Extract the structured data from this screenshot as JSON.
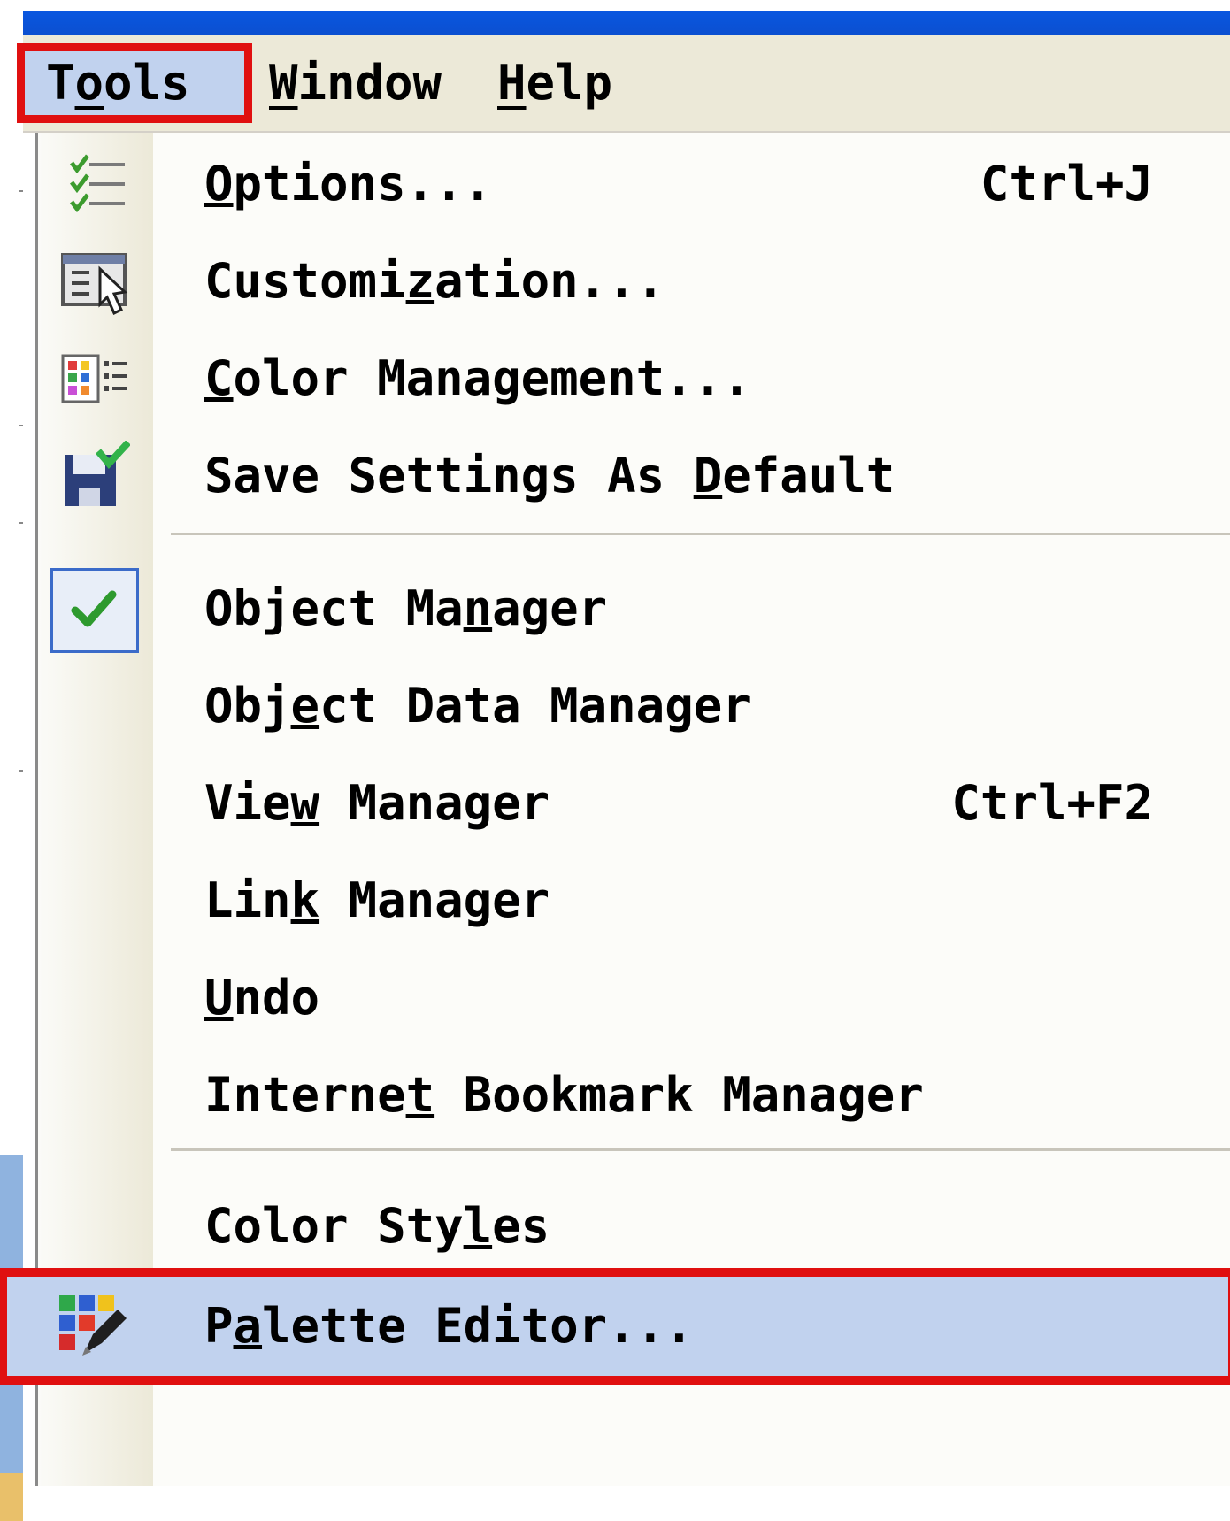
{
  "menubar": {
    "items": [
      {
        "pre": "T",
        "mn": "o",
        "post": "ols"
      },
      {
        "pre": "",
        "mn": "W",
        "post": "indow"
      },
      {
        "pre": "",
        "mn": "H",
        "post": "elp"
      }
    ]
  },
  "dropdown": {
    "items": [
      {
        "pre": "",
        "mn": "O",
        "post": "ptions...",
        "shortcut": "Ctrl+J",
        "icon": "options-checklist-icon"
      },
      {
        "pre": "Customi",
        "mn": "z",
        "post": "ation...",
        "shortcut": "",
        "icon": "customization-icon"
      },
      {
        "pre": "",
        "mn": "C",
        "post": "olor Management...",
        "shortcut": "",
        "icon": "color-management-icon"
      },
      {
        "pre": "Save Settings As ",
        "mn": "D",
        "post": "efault",
        "shortcut": "",
        "icon": "save-settings-icon"
      },
      {
        "pre": "Object Ma",
        "mn": "n",
        "post": "ager",
        "shortcut": "",
        "icon": "checkmark-icon",
        "checked": true
      },
      {
        "pre": "Obj",
        "mn": "e",
        "post": "ct Data Manager",
        "shortcut": ""
      },
      {
        "pre": "Vie",
        "mn": "w",
        "post": " Manager",
        "shortcut": "Ctrl+F2"
      },
      {
        "pre": "Lin",
        "mn": "k",
        "post": " Manager",
        "shortcut": ""
      },
      {
        "pre": "",
        "mn": "U",
        "post": "ndo",
        "shortcut": ""
      },
      {
        "pre": "Interne",
        "mn": "t",
        "post": " Bookmark Manager",
        "shortcut": ""
      },
      {
        "pre": "Color Sty",
        "mn": "l",
        "post": "es",
        "shortcut": ""
      },
      {
        "pre": "P",
        "mn": "a",
        "post": "lette Editor...",
        "shortcut": "",
        "icon": "palette-editor-icon",
        "highlighted": true
      }
    ]
  },
  "colors": {
    "highlight_border": "#e01010",
    "highlight_fill": "#c1d2ee",
    "titlebar": "#0a57e0",
    "menubar_bg": "#ece9d8"
  }
}
